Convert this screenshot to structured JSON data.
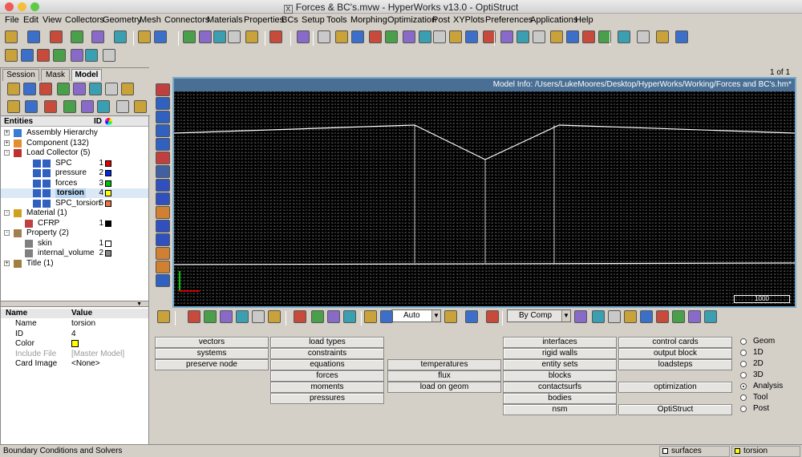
{
  "window": {
    "title": "Forces & BC's.mvw - HyperWorks v13.0 - OptiStruct"
  },
  "menu": [
    "File",
    "Edit",
    "View",
    "Collectors",
    "Geometry",
    "Mesh",
    "Connectors",
    "Materials",
    "Properties",
    "BCs",
    "Setup",
    "Tools",
    "Morphing",
    "Optimization",
    "Post",
    "XYPlots",
    "Preferences",
    "Applications",
    "Help"
  ],
  "browser": {
    "tabs": [
      "Session",
      "Mask",
      "Model"
    ],
    "active_tab": "Model",
    "col_entities": "Entities",
    "col_id": "ID",
    "tree": [
      {
        "label": "Assembly Hierarchy",
        "level": 0,
        "expander": "+",
        "icon": "assembly-icon"
      },
      {
        "label": "Component (132)",
        "level": 0,
        "expander": "+",
        "icon": "component-icon"
      },
      {
        "label": "Load Collector (5)",
        "level": 0,
        "expander": "-",
        "icon": "load-collector-icon"
      },
      {
        "label": "SPC",
        "level": 2,
        "id": "1",
        "color": "#e00000",
        "icon": "loadcol-icon"
      },
      {
        "label": "pressure",
        "level": 2,
        "id": "2",
        "color": "#0028e0",
        "icon": "loadcol-icon"
      },
      {
        "label": "forces",
        "level": 2,
        "id": "3",
        "color": "#00c000",
        "icon": "loadcol-icon"
      },
      {
        "label": "torsion",
        "level": 2,
        "id": "4",
        "color": "#ffff00",
        "icon": "loadcol-icon",
        "selected": true
      },
      {
        "label": "SPC_torsion",
        "level": 2,
        "id": "5",
        "color": "#f07040",
        "icon": "loadcol-icon"
      },
      {
        "label": "Material (1)",
        "level": 0,
        "expander": "-",
        "icon": "material-icon"
      },
      {
        "label": "CFRP",
        "level": 1,
        "id": "1",
        "color": "#000000",
        "icon": "cfrp-icon"
      },
      {
        "label": "Property (2)",
        "level": 0,
        "expander": "-",
        "icon": "property-icon"
      },
      {
        "label": "skin",
        "level": 1,
        "id": "1",
        "color": "#ffffff",
        "icon": "prop-item-icon"
      },
      {
        "label": "internal_volume",
        "level": 1,
        "id": "2",
        "color": "#888888",
        "icon": "prop-item-icon"
      },
      {
        "label": "Title (1)",
        "level": 0,
        "expander": "+",
        "icon": "title-icon"
      }
    ]
  },
  "properties": {
    "col_name": "Name",
    "col_value": "Value",
    "rows": [
      {
        "k": "Name",
        "v": "torsion"
      },
      {
        "k": "ID",
        "v": "4"
      },
      {
        "k": "Color",
        "v": "",
        "swatch": "#ffff00"
      },
      {
        "k": "Include File",
        "v": "[Master Model]",
        "dim": true
      },
      {
        "k": "Card Image",
        "v": "<None>"
      }
    ]
  },
  "viewport": {
    "page": "1 of 1",
    "model_info": "Model Info: /Users/LukeMoores/Desktop/HyperWorks/Working/Forces and BC's.hm*",
    "scale": "1000"
  },
  "bottom_toolbar": {
    "auto": "Auto",
    "by_comp": "By Comp"
  },
  "panel": {
    "col1": [
      "vectors",
      "systems",
      "preserve node"
    ],
    "col2": [
      "load types",
      "constraints",
      "equations",
      "forces",
      "moments",
      "pressures"
    ],
    "col3": [
      "temperatures",
      "flux",
      "load on geom"
    ],
    "col4": [
      "interfaces",
      "rigid walls",
      "entity sets",
      "blocks",
      "contactsurfs",
      "bodies",
      "nsm"
    ],
    "col5": [
      "control cards",
      "output block",
      "loadsteps",
      "optimization",
      "OptiStruct"
    ],
    "radios": [
      "Geom",
      "1D",
      "2D",
      "3D",
      "Analysis",
      "Tool",
      "Post"
    ],
    "selected_radio": "Analysis"
  },
  "status": {
    "text": "Boundary Conditions and Solvers",
    "comp": "surfaces",
    "loadcol": "torsion",
    "loadcol_color": "#ffff00"
  }
}
